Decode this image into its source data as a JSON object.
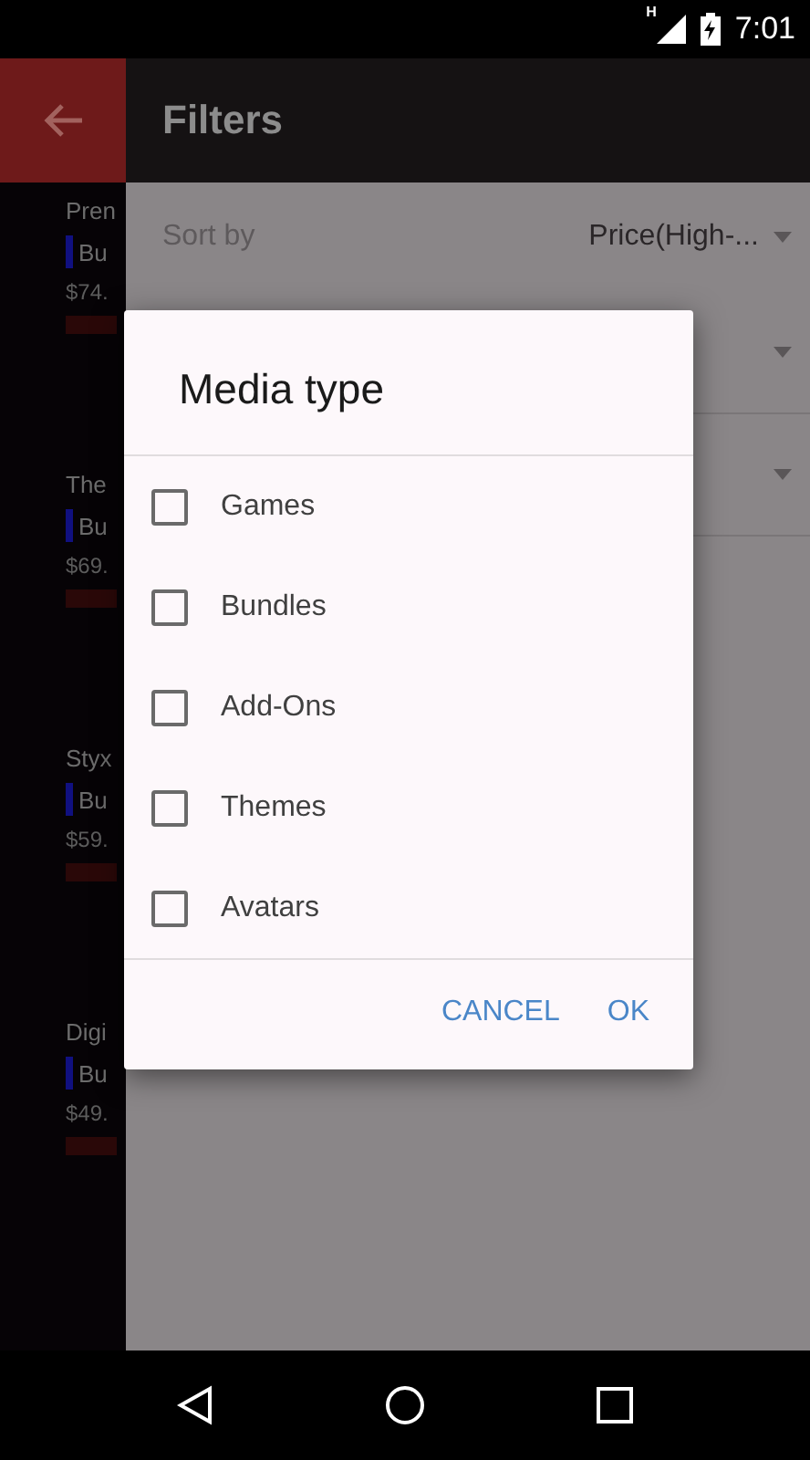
{
  "status_bar": {
    "network": "H",
    "time": "7:01"
  },
  "toolbar": {
    "title": "Filters"
  },
  "background_list": [
    {
      "name": "Pren",
      "tag": "Bu",
      "price": "$74."
    },
    {
      "name": "The",
      "tag": "Bu",
      "price": "$69."
    },
    {
      "name": "Styx",
      "tag": "Bu",
      "price": "$59."
    },
    {
      "name": "Digi",
      "tag": "Bu",
      "price": "$49."
    }
  ],
  "filters": [
    {
      "kind": "sort",
      "label": "Sort by",
      "value": "Price(High-..."
    },
    {
      "kind": "dropdown"
    },
    {
      "kind": "dropdown"
    }
  ],
  "dialog": {
    "title": "Media type",
    "options": [
      {
        "label": "Games",
        "checked": false
      },
      {
        "label": "Bundles",
        "checked": false
      },
      {
        "label": "Add-Ons",
        "checked": false
      },
      {
        "label": "Themes",
        "checked": false
      },
      {
        "label": "Avatars",
        "checked": false
      }
    ],
    "buttons": [
      "CANCEL",
      "OK"
    ]
  }
}
